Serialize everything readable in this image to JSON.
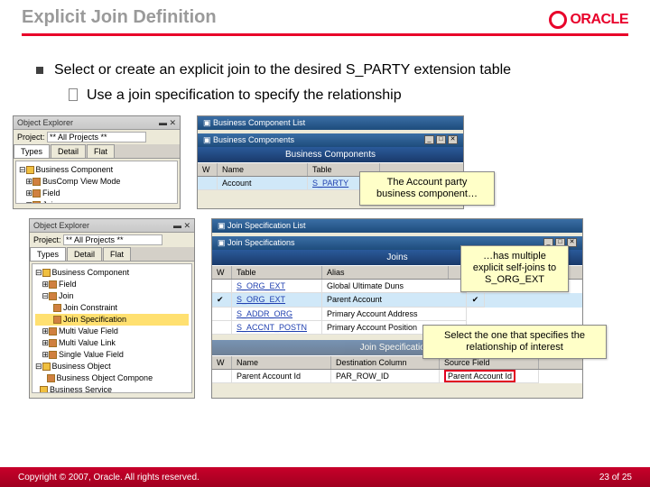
{
  "header": {
    "title": "Explicit Join Definition",
    "logo": "ORACLE"
  },
  "bullets": {
    "main": "Select or create an explicit join to the desired S_PARTY extension table",
    "sub": "Use a join specification to specify the relationship"
  },
  "explorer1": {
    "title": "Object Explorer",
    "proj_label": "Project:",
    "proj_value": "** All Projects **",
    "tabs": [
      "Types",
      "Detail",
      "Flat"
    ],
    "tree": [
      "Business Component",
      "BusComp View Mode",
      "Field",
      "Join"
    ]
  },
  "bclist": {
    "winTitle": "Business Component List",
    "gridTitle": "Business Components",
    "cols": [
      "W",
      "Name",
      "Table"
    ],
    "row": {
      "name": "Account",
      "table": "S_PARTY"
    }
  },
  "callout1": "The Account party business component…",
  "explorer2": {
    "title": "Object Explorer",
    "proj_label": "Project:",
    "proj_value": "** All Projects **",
    "tabs": [
      "Types",
      "Detail",
      "Flat"
    ],
    "tree": [
      "Business Component",
      "Field",
      "Join",
      "Join Constraint",
      "Join Specification",
      "Multi Value Field",
      "Multi Value Link",
      "Single Value Field",
      "Business Object",
      "Business Object Compone",
      "Business Service"
    ]
  },
  "joinspec": {
    "winTitle": "Join Specification List",
    "gridTitle": "Joins",
    "cols": [
      "W",
      "Table",
      "Alias"
    ],
    "rows": [
      {
        "table": "S_ORG_EXT",
        "alias": "Global Ultimate Duns"
      },
      {
        "table": "S_ORG_EXT",
        "alias": "Parent Account"
      },
      {
        "table": "S_ADDR_ORG",
        "alias": "Primary Account Address"
      },
      {
        "table": "S_ACCNT_POSTN",
        "alias": "Primary Account Position"
      }
    ],
    "gridTitle2": "Join Specifications",
    "cols2": [
      "W",
      "Name",
      "Destination Column",
      "Source Field"
    ],
    "row2": {
      "name": "Parent Account Id",
      "dest": "PAR_ROW_ID",
      "src": "Parent Account Id"
    }
  },
  "callout2": "…has multiple explicit self-joins to S_ORG_EXT",
  "callout3": "Select the one that specifies the relationship of interest",
  "footer": {
    "copyright": "Copyright © 2007, Oracle. All rights reserved.",
    "page": "23 of 25"
  }
}
